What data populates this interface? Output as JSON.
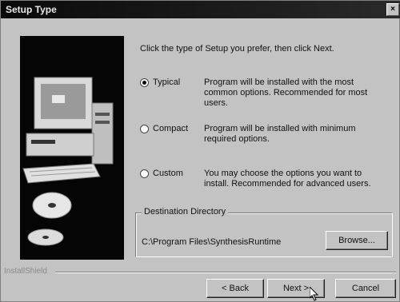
{
  "window": {
    "title": "Setup Type",
    "close_glyph": "×"
  },
  "instruction": "Click the type of Setup you prefer, then click Next.",
  "options": [
    {
      "label": "Typical",
      "description": "Program will be installed with the most common options. Recommended for most users.",
      "selected": true
    },
    {
      "label": "Compact",
      "description": "Program will be installed with minimum required options.",
      "selected": false
    },
    {
      "label": "Custom",
      "description": "You may choose the options you want to install. Recommended for advanced users.",
      "selected": false
    }
  ],
  "destination": {
    "legend": "Destination Directory",
    "path": "C:\\Program Files\\SynthesisRuntime",
    "browse_label": "Browse..."
  },
  "footer": {
    "brand": "InstallShield",
    "back_label": "< Back",
    "next_label": "Next >",
    "cancel_label": "Cancel"
  },
  "colors": {
    "dialog_bg": "#c3c3c3",
    "titlebar_bg": "#0a0a0a",
    "art_bg": "#050505"
  }
}
